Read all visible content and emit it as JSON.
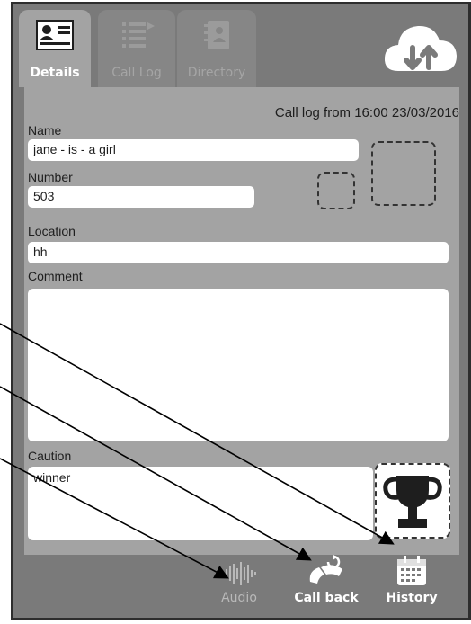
{
  "tabs": [
    {
      "label": "Details",
      "icon": "details-card-icon",
      "active": true
    },
    {
      "label": "Call Log",
      "icon": "call-log-list-icon",
      "active": false
    },
    {
      "label": "Directory",
      "icon": "directory-book-icon",
      "active": false
    }
  ],
  "header": {
    "call_log_info": "Call log from 16:00 23/03/2016"
  },
  "form": {
    "name_label": "Name",
    "name_value": "jane - is - a girl",
    "number_label": "Number",
    "number_value": "503",
    "location_label": "Location",
    "location_value": "hh",
    "comment_label": "Comment",
    "comment_value": "",
    "caution_label": "Caution",
    "caution_value": "winner"
  },
  "actions": {
    "audio_label": "Audio",
    "callback_label": "Call back",
    "history_label": "History"
  },
  "colors": {
    "frame_bg": "#7a7a7a",
    "panel_bg": "#a3a3a3",
    "tab_active": "#a3a3a3",
    "tab_inactive": "#868686"
  }
}
